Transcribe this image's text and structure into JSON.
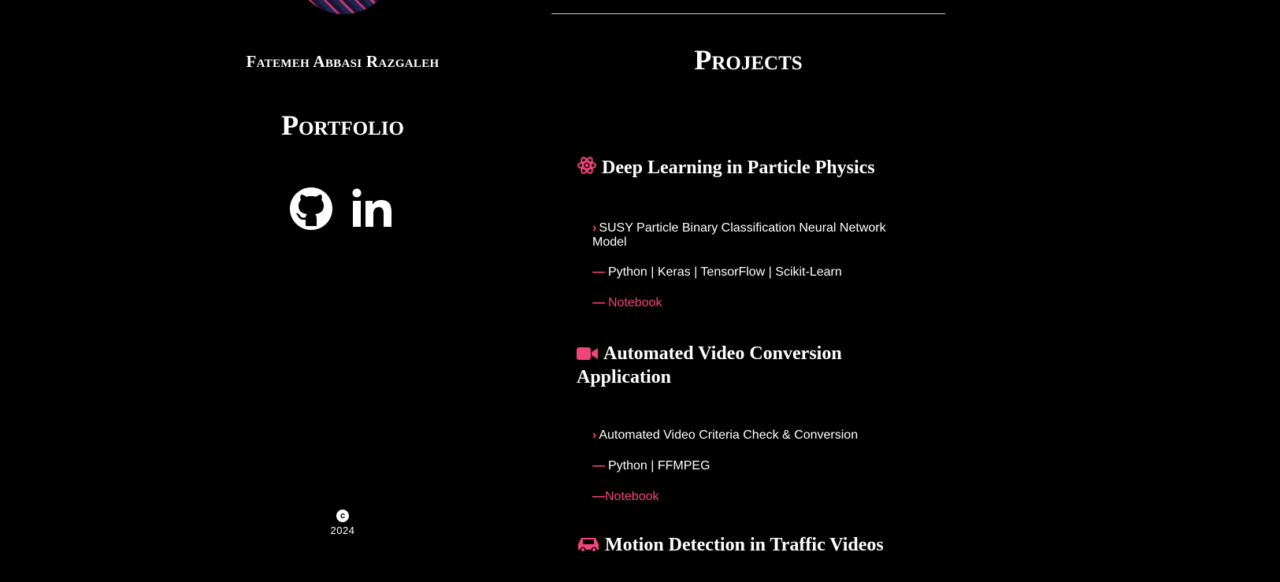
{
  "sidebar": {
    "owner_name": "Fatemeh Abbasi Razgaleh",
    "portfolio_title": "Portfolio",
    "social": [
      {
        "icon": "github-icon"
      },
      {
        "icon": "linkedin-icon"
      }
    ],
    "copyright_symbol": "c",
    "year": "2024"
  },
  "main": {
    "section_title": "Projects",
    "projects": [
      {
        "icon": "atom-icon",
        "title": "Deep Learning in Particle Physics",
        "description": "SUSY Particle Binary Classification Neural Network Model",
        "stack": "Python | Keras | TensorFlow | Scikit-Learn",
        "link_label": "Notebook"
      },
      {
        "icon": "video-camera-icon",
        "title": "Automated Video Conversion Application",
        "description": "Automated Video Criteria Check & Conversion",
        "stack": "Python | FFMPEG",
        "link_label": "Notebook"
      },
      {
        "icon": "car-icon",
        "title": "Motion Detection in Traffic Videos"
      }
    ]
  },
  "colors": {
    "background": "#000000",
    "text": "#ffffff",
    "accent": "#f0447a"
  }
}
